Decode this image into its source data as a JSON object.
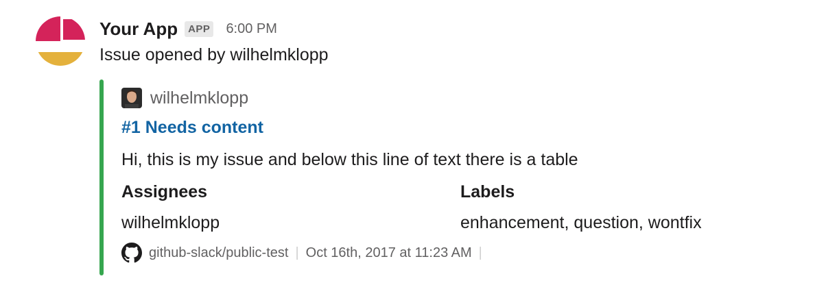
{
  "message": {
    "app_name": "Your App",
    "badge": "APP",
    "time": "6:00 PM",
    "text": "Issue opened by wilhelmklopp"
  },
  "attachment": {
    "color": "#36a64f",
    "author_name": "wilhelmklopp",
    "title": "#1 Needs content",
    "text": "Hi, this is my issue and below this line of text there is a table",
    "fields": [
      {
        "title": "Assignees",
        "value": "wilhelmklopp"
      },
      {
        "title": "Labels",
        "value": "enhancement, question, wontfix"
      }
    ],
    "footer": "github-slack/public-test",
    "footer_icon": "github-icon",
    "footer_time": "Oct 16th, 2017 at 11:23 AM"
  }
}
